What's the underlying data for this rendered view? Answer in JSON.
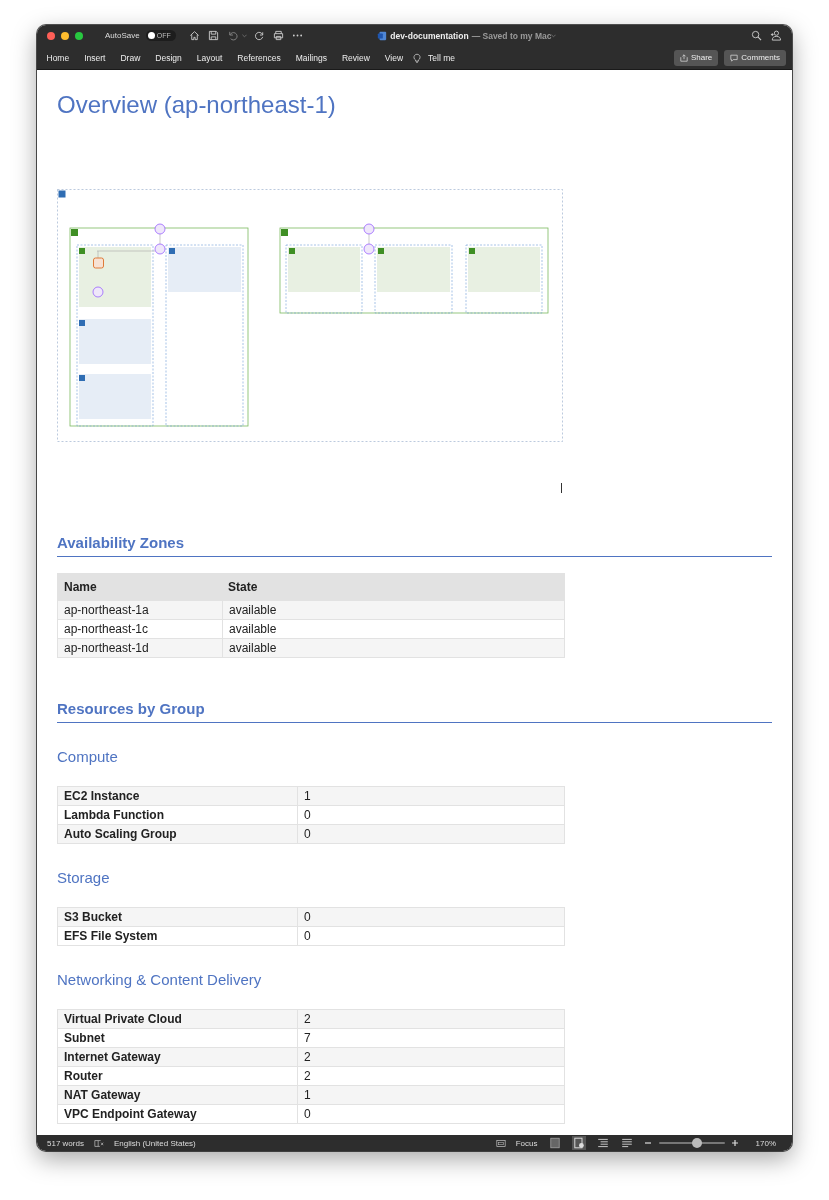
{
  "window": {
    "title": "dev-documentation",
    "save_status": "— Saved to my Mac",
    "autosave": {
      "label": "AutoSave",
      "on": false,
      "toggle_text": "OFF"
    }
  },
  "ribbon": {
    "tabs": [
      {
        "label": "Home",
        "selected": false
      },
      {
        "label": "Insert",
        "selected": false
      },
      {
        "label": "Draw",
        "selected": false
      },
      {
        "label": "Design",
        "selected": false
      },
      {
        "label": "Layout",
        "selected": false
      },
      {
        "label": "References",
        "selected": false
      },
      {
        "label": "Mailings",
        "selected": false
      },
      {
        "label": "Review",
        "selected": false
      },
      {
        "label": "View",
        "selected": false
      }
    ],
    "tell_me": "Tell me",
    "buttons": [
      {
        "kind": "share",
        "label": "Share"
      },
      {
        "kind": "comments",
        "label": "Comments"
      }
    ]
  },
  "document": {
    "title": "Overview (ap-northeast-1)",
    "diagram": {
      "kind": "architecture"
    },
    "blocks": [
      {
        "kind": "heading1",
        "text": "Availability Zones"
      },
      {
        "kind": "table",
        "columns": [
          "Name",
          "State"
        ],
        "rows": [
          [
            "ap-northeast-1a",
            "available"
          ],
          [
            "ap-northeast-1c",
            "available"
          ],
          [
            "ap-northeast-1d",
            "available"
          ]
        ]
      },
      {
        "kind": "heading1",
        "text": "Resources by Group"
      },
      {
        "kind": "heading2",
        "text": "Compute"
      },
      {
        "kind": "counts",
        "rows": [
          [
            "EC2 Instance",
            "1"
          ],
          [
            "Lambda Function",
            "0"
          ],
          [
            "Auto Scaling Group",
            "0"
          ]
        ]
      },
      {
        "kind": "heading2",
        "text": "Storage"
      },
      {
        "kind": "counts",
        "rows": [
          [
            "S3 Bucket",
            "0"
          ],
          [
            "EFS File System",
            "0"
          ]
        ]
      },
      {
        "kind": "heading2",
        "text": "Networking & Content Delivery"
      },
      {
        "kind": "counts",
        "rows": [
          [
            "Virtual Private Cloud",
            "2"
          ],
          [
            "Subnet",
            "7"
          ],
          [
            "Internet Gateway",
            "2"
          ],
          [
            "Router",
            "2"
          ],
          [
            "NAT Gateway",
            "1"
          ],
          [
            "VPC Endpoint Gateway",
            "0"
          ]
        ]
      }
    ]
  },
  "status_bar": {
    "words": "517 words",
    "language": "English (United States)",
    "focus": "Focus",
    "zoom": {
      "level": 0.58,
      "reading": "170%"
    }
  }
}
